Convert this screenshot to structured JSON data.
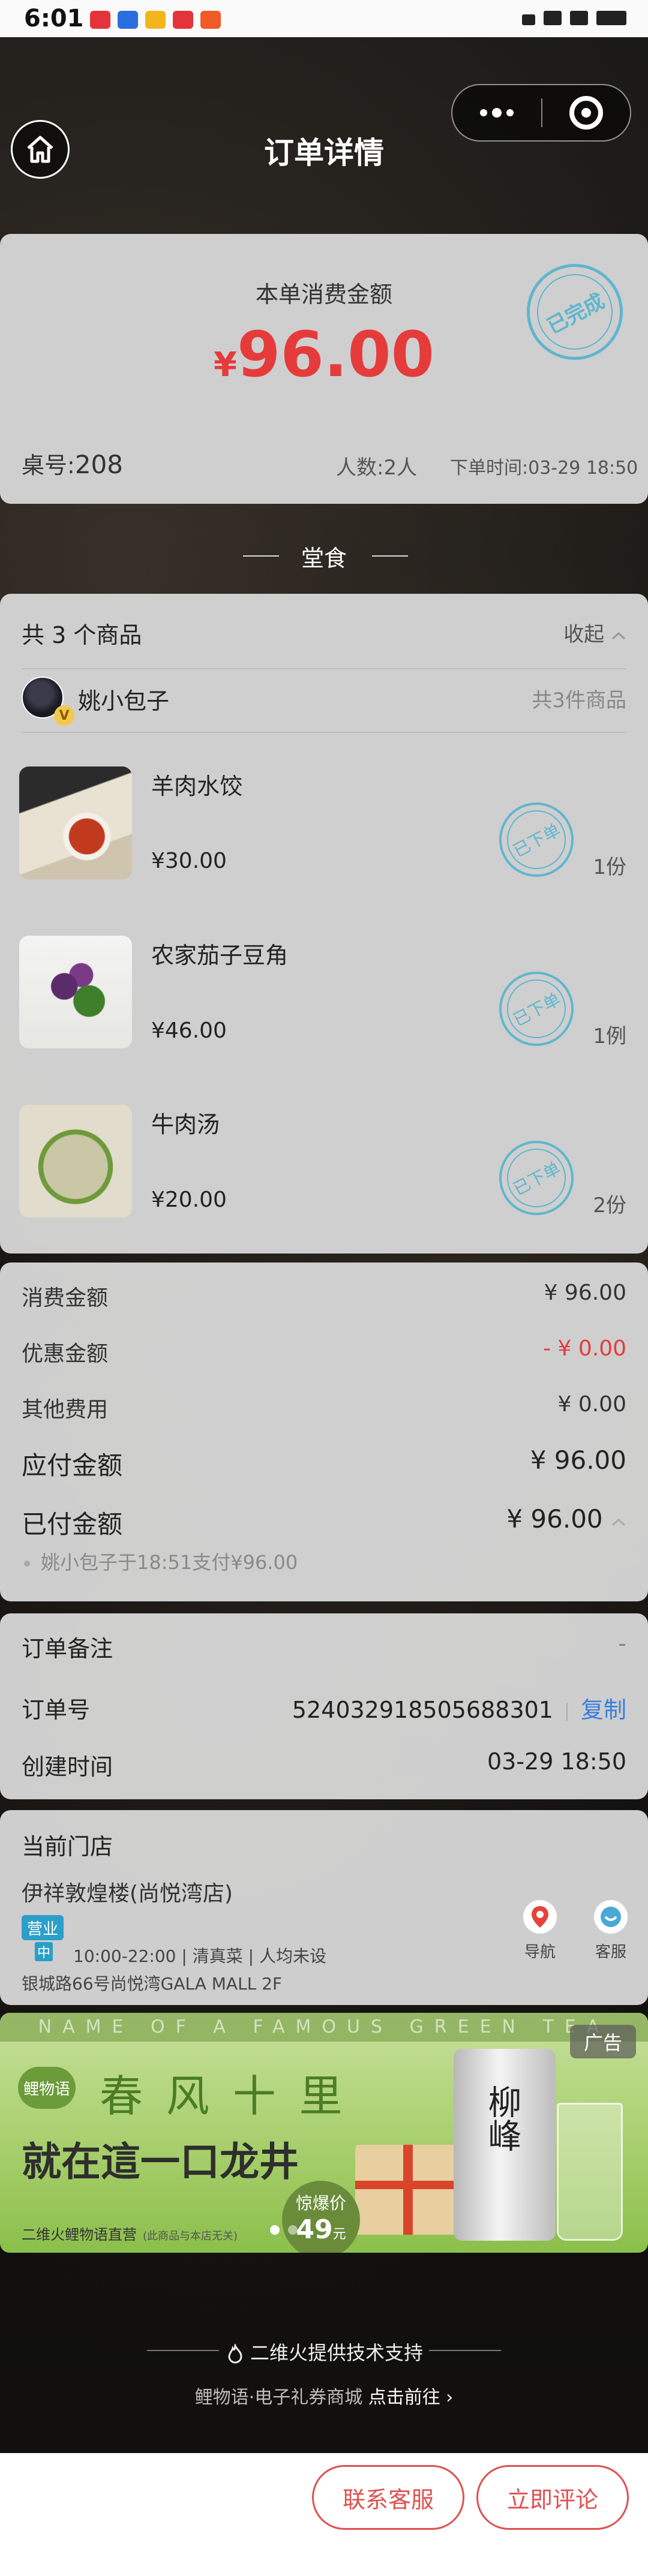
{
  "status_bar": {
    "time": "6:01"
  },
  "nav": {
    "title": "订单详情"
  },
  "summary": {
    "amount_label": "本单消费金额",
    "currency": "¥",
    "amount": "96.00",
    "stamp": "已完成",
    "table_label": "桌号:",
    "table_no": "208",
    "people": "人数:2人",
    "order_time": "下单时间:03-29 18:50"
  },
  "dine_type": "堂食",
  "items": {
    "header": "共 3 个商品",
    "collapse_label": "收起",
    "user_name": "姚小包子",
    "user_badge": "V",
    "user_count": "共3件商品",
    "list": [
      {
        "name": "羊肉水饺",
        "price": "¥30.00",
        "qty": "1份",
        "stamp": "已下单"
      },
      {
        "name": "农家茄子豆角",
        "price": "¥46.00",
        "qty": "1例",
        "stamp": "已下单"
      },
      {
        "name": "牛肉汤",
        "price": "¥20.00",
        "qty": "2份",
        "stamp": "已下单"
      }
    ]
  },
  "fees": {
    "consume_label": "消费金额",
    "consume_value": "¥ 96.00",
    "discount_label": "优惠金额",
    "discount_value": "- ¥ 0.00",
    "other_label": "其他费用",
    "other_value": "¥ 0.00",
    "payable_label": "应付金额",
    "payable_value": "¥ 96.00",
    "paid_label": "已付金额",
    "paid_value": "¥ 96.00",
    "pay_note": "姚小包子于18:51支付¥96.00"
  },
  "order_info": {
    "remark_label": "订单备注",
    "remark_value": "-",
    "order_no_label": "订单号",
    "order_no": "524032918505688301",
    "copy_label": "复制",
    "created_label": "创建时间",
    "created_value": "03-29 18:50"
  },
  "store": {
    "title": "当前门店",
    "name": "伊祥敦煌楼(尚悦湾店)",
    "status": "营业",
    "status_sub": "中",
    "hours": "10:00-22:00 | 清真菜 | 人均未设",
    "address": "银城路66号尚悦湾GALA MALL 2F",
    "nav_label": "导航",
    "service_label": "客服"
  },
  "ad": {
    "band_text": "NAME OF A FAMOUS GREEN TEA",
    "tag": "广告",
    "logo": "鲤物语",
    "slogan1": "春 风 十 里",
    "slogan2": "就在這一口龙井",
    "price_label": "惊爆价",
    "price": "49",
    "price_unit": "元",
    "sub": "二维火鲤物语直营",
    "sub_note": "(此商品与本店无关)",
    "can_label": "柳峰"
  },
  "footer": {
    "tech": "二维火提供技术支持",
    "mall_text": "鲤物语·电子礼券商城",
    "mall_link": "点击前往 ›"
  },
  "actions": {
    "contact": "联系客服",
    "review": "立即评论"
  },
  "colors": {
    "accent_red": "#e63b3b",
    "stamp_blue": "#5fb6cf",
    "link_blue": "#3b7de0"
  }
}
